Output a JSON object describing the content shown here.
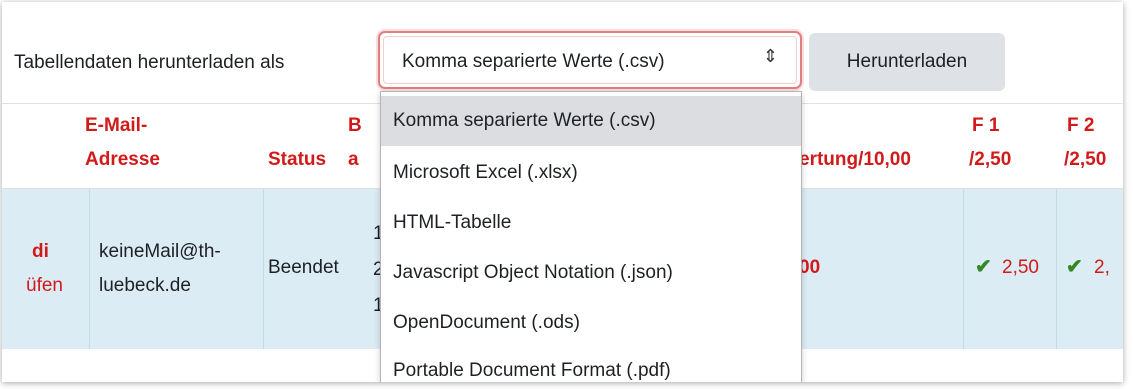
{
  "toolbar": {
    "label": "Tabellendaten herunterladen als",
    "select_value": "Komma separierte Werte (.csv)",
    "select_arrow": "⇕",
    "download_label": "Herunterladen"
  },
  "dropdown": {
    "options": [
      "Komma separierte Werte (.csv)",
      "Microsoft Excel (.xlsx)",
      "HTML-Tabelle",
      "Javascript Object Notation (.json)",
      "OpenDocument (.ods)",
      "Portable Document Format (.pdf)"
    ],
    "selected_index": 0
  },
  "table": {
    "headers": {
      "email_line1": "E-Mail-",
      "email_line2": "Adresse",
      "status": "Status",
      "col4_fragment": "B",
      "col4_fragment2": "a",
      "grade_fragment": "ertung/10,00",
      "f1_line1": "F 1",
      "f1_line2": "/2,50",
      "f2_line1": "F 2",
      "f2_line2": "/2,50"
    },
    "row": {
      "name_fragment1": "di",
      "name_fragment2": "üfen",
      "email_line1": "keineMail@th-",
      "email_line2": "luebeck.de",
      "status": "Beendet",
      "col4_frag1": "1",
      "col4_frag2": "2",
      "col4_frag3": "1",
      "grade_fragment": "00",
      "f1_value": "2,50",
      "f2_value": "2,"
    }
  },
  "colors": {
    "accent_red": "#d11a1a",
    "check_green": "#358723",
    "row_bg": "#dcecf5",
    "button_bg": "#dee2e6"
  }
}
